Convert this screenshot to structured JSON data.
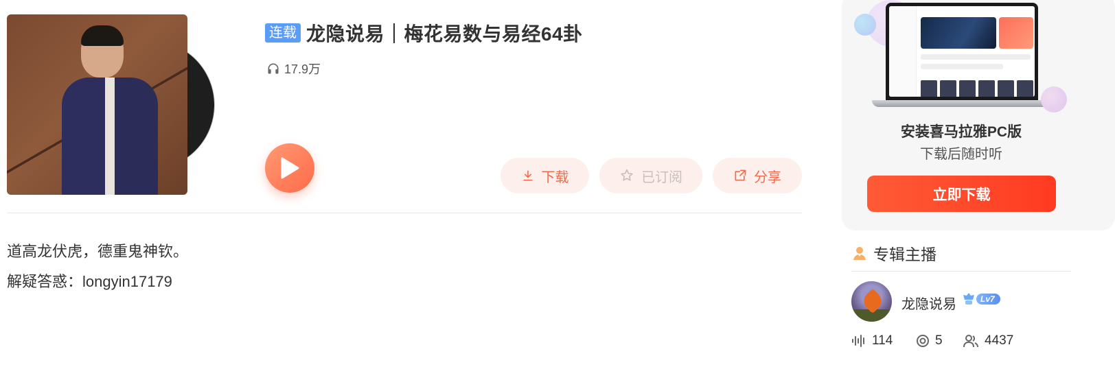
{
  "album": {
    "badge": "连载",
    "title": "龙隐说易｜梅花易数与易经64卦",
    "play_count": "17.9万"
  },
  "actions": {
    "download": "下载",
    "subscribed": "已订阅",
    "share": "分享"
  },
  "intro": {
    "line1": "道高龙伏虎，德重鬼神钦。",
    "line2": "解疑答惑：longyin17179"
  },
  "pc_promo": {
    "title": "安装喜马拉雅PC版",
    "subtitle": "下载后随时听",
    "button": "立即下载"
  },
  "host": {
    "heading": "专辑主播",
    "name": "龙隐说易",
    "level": "Lv7",
    "tracks": "114",
    "subscriptions": "5",
    "fans": "4437"
  },
  "colors": {
    "accent": "#f16c4d",
    "badge_blue": "#5a9cf8",
    "download_red": "#ff4a2c"
  },
  "icons": {
    "play_count": "headphones-icon",
    "download": "download-icon",
    "subscribed": "star-icon",
    "share": "share-icon",
    "host": "person-icon",
    "tracks": "soundwave-icon",
    "subscriptions": "target-icon",
    "fans": "people-icon"
  }
}
